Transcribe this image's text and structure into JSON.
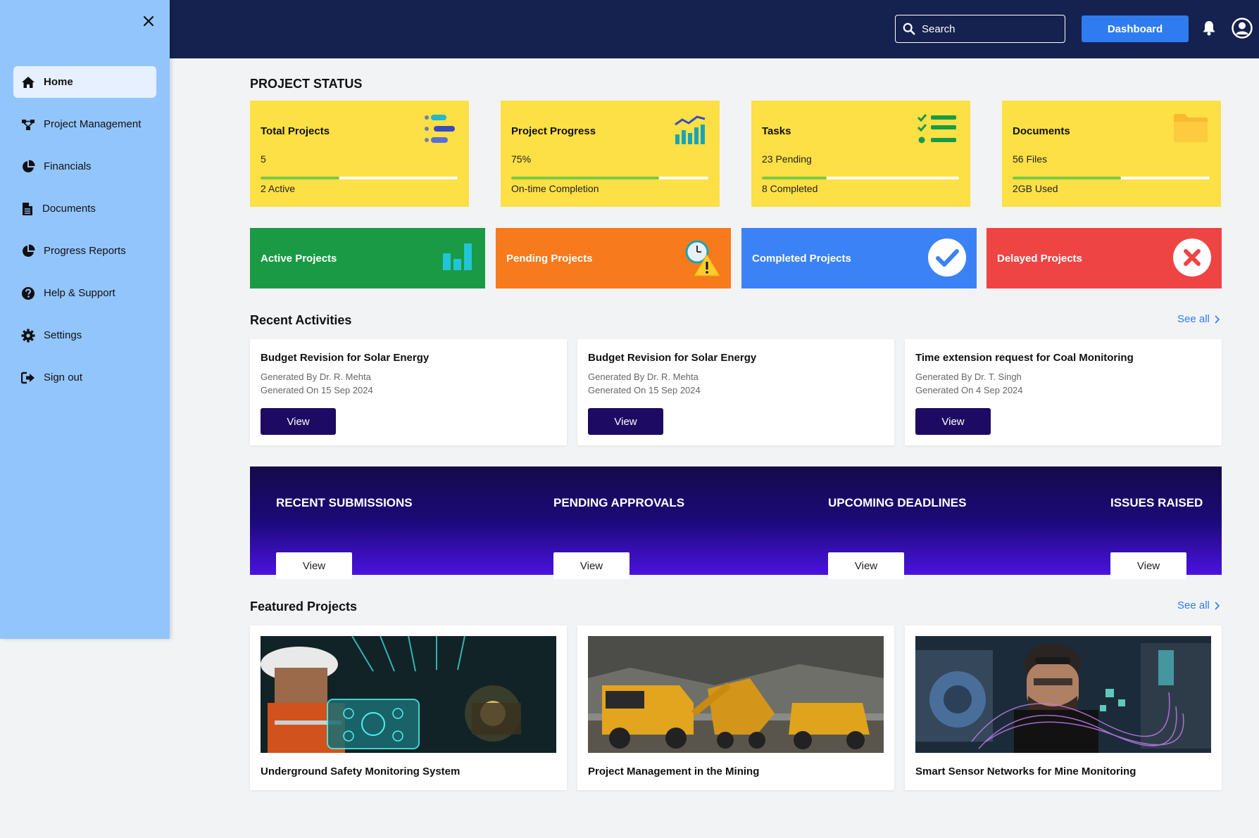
{
  "header": {
    "search_placeholder": "Search",
    "dashboard_label": "Dashboard",
    "icons": [
      "search-icon",
      "bell-icon",
      "user-avatar-icon"
    ]
  },
  "sidebar": {
    "items": [
      {
        "label": "Home",
        "icon": "home-icon",
        "active": true
      },
      {
        "label": "Project Management",
        "icon": "network-icon"
      },
      {
        "label": "Financials",
        "icon": "pie-chart-icon"
      },
      {
        "label": "Documents",
        "icon": "document-icon"
      },
      {
        "label": "Progress Reports",
        "icon": "pie-chart-icon"
      },
      {
        "label": "Help & Support",
        "icon": "question-icon"
      },
      {
        "label": "Settings",
        "icon": "gear-icon"
      },
      {
        "label": "Sign out",
        "icon": "sign-out-icon"
      }
    ]
  },
  "status": {
    "title": "PROJECT STATUS",
    "cards": [
      {
        "title": "Total Projects",
        "value": "5",
        "footer": "2 Active",
        "progress": 0.4
      },
      {
        "title": "Project Progress",
        "value": "75%",
        "footer": "On-time Completion",
        "progress": 0.75
      },
      {
        "title": "Tasks",
        "value": "23 Pending",
        "footer": "8 Completed",
        "progress": 0.33
      },
      {
        "title": "Documents",
        "value": "56 Files",
        "footer": "2GB Used",
        "progress": 0.55
      }
    ]
  },
  "project_cards": [
    {
      "label": "Active Projects",
      "color": "#1a9a44"
    },
    {
      "label": "Pending Projects",
      "color": "#f77a1c"
    },
    {
      "label": "Completed Projects",
      "color": "#3b82f6"
    },
    {
      "label": "Delayed Projects",
      "color": "#ef4444"
    }
  ],
  "activities": {
    "title": "Recent Activities",
    "see_all": "See all",
    "items": [
      {
        "title": "Budget Revision for Solar Energy",
        "by": "Generated By Dr. R. Mehta",
        "on": "Generated On 15 Sep 2024",
        "button": "View"
      },
      {
        "title": "Budget Revision for Solar Energy",
        "by": "Generated By Dr. R. Mehta",
        "on": "Generated On 15 Sep 2024",
        "button": "View"
      },
      {
        "title": "Time extension request for Coal Monitoring",
        "by": "Generated By Dr. T. Singh",
        "on": "Generated On 4 Sep 2024",
        "button": "View"
      }
    ]
  },
  "banner": {
    "items": [
      {
        "title": "RECENT SUBMISSIONS",
        "button": "View"
      },
      {
        "title": "PENDING APPROVALS",
        "button": "View"
      },
      {
        "title": "UPCOMING DEADLINES",
        "button": "View"
      },
      {
        "title": "ISSUES RAISED",
        "button": "View"
      }
    ]
  },
  "featured": {
    "title": "Featured Projects",
    "see_all": "See all",
    "items": [
      {
        "title": "Underground Safety Monitoring System"
      },
      {
        "title": "Project Management in the Mining"
      },
      {
        "title": "Smart Sensor Networks for Mine Monitoring"
      }
    ]
  }
}
